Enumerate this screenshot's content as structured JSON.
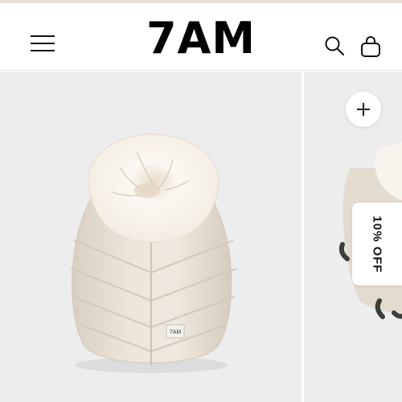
{
  "header": {
    "logo_text": "7AM",
    "menu_icon": "hamburger-menu-icon",
    "search_icon": "search-icon",
    "cart_icon": "shopping-bag-icon"
  },
  "products": [
    {
      "image": "cream-puffer-cocoon-with-fur-collar",
      "label_tag": "7AM"
    },
    {
      "image": "cream-puffer-cover-partial",
      "badge": "10% OFF",
      "add_icon": "plus-icon"
    }
  ],
  "colors": {
    "top_strip": "#e8e1d8",
    "product_bg": "#ededed",
    "puffer": "#e6ddd0",
    "fur": "#faf7f2",
    "text": "#000000"
  }
}
